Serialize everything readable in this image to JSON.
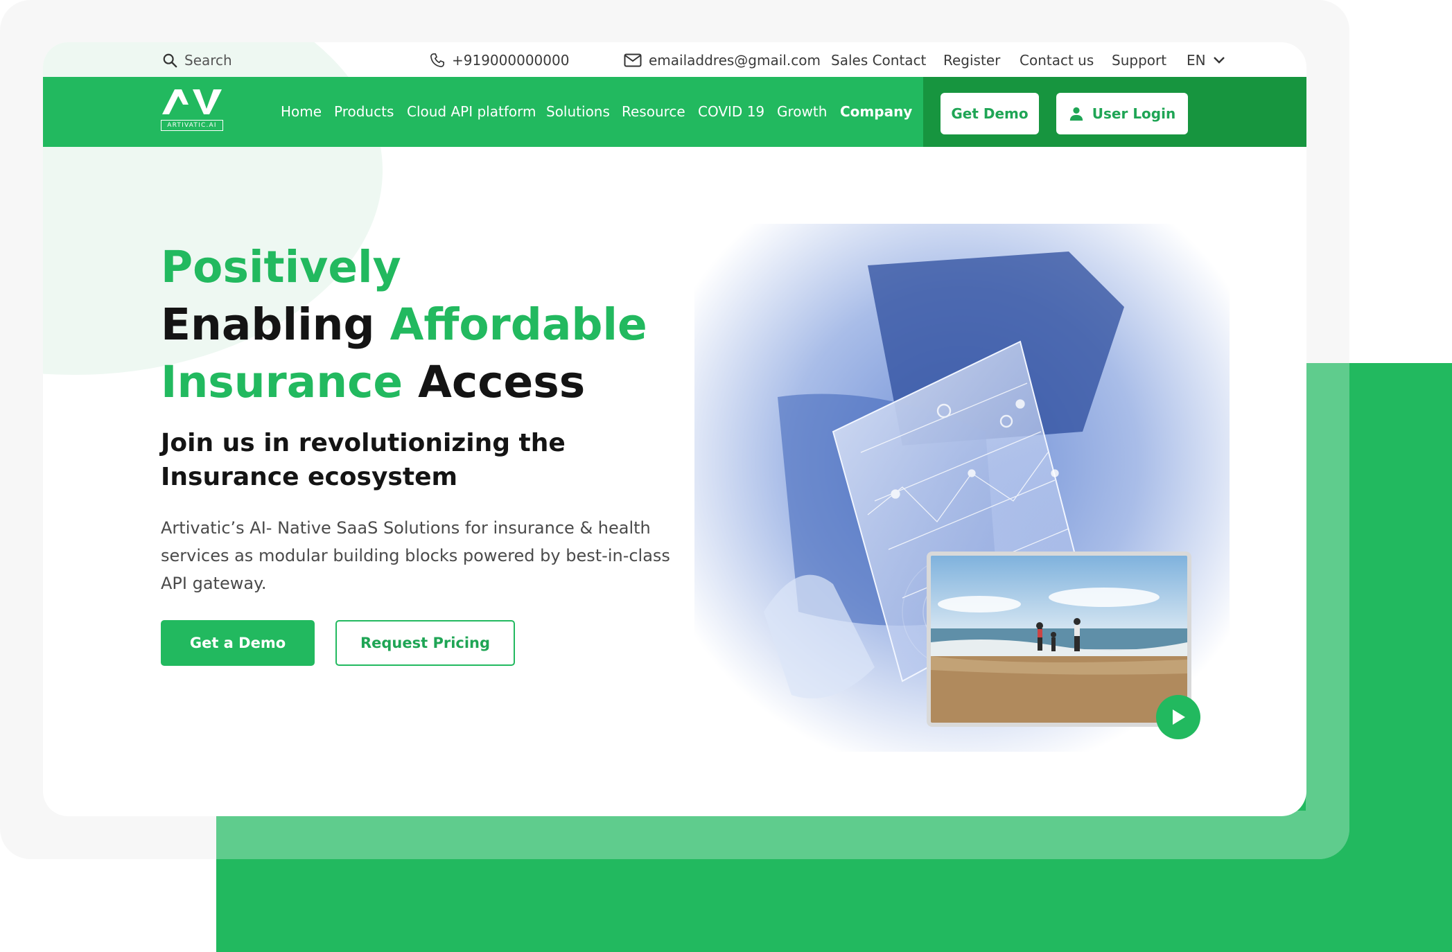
{
  "topbar": {
    "search_placeholder": "Search",
    "phone": "+919000000000",
    "email": "emailaddres@gmail.com",
    "links": [
      "Sales Contact",
      "Register",
      "Contact us",
      "Support"
    ],
    "language": "EN"
  },
  "logo": {
    "mark": "AV",
    "wordmark": "ARTIVATIC.AI"
  },
  "nav": {
    "items": [
      "Home",
      "Products",
      "Cloud API platform",
      "Solutions",
      "Resource",
      "COVID 19",
      "Growth",
      "Company"
    ],
    "get_demo": "Get Demo",
    "user_login": "User Login"
  },
  "hero": {
    "line1": "Positively",
    "line2_a": "Enabling",
    "line2_b": "Affordable",
    "line3_a": "Insurance",
    "line3_b": "Access",
    "subtitle": "Join us in revolutionizing the Insurance ecosystem",
    "description": "Artivatic’s AI- Native SaaS Solutions for insurance & health services as modular building blocks powered by best-in-class API gateway.",
    "cta_primary": "Get a Demo",
    "cta_secondary": "Request Pricing"
  },
  "colors": {
    "brand_green": "#22b95f",
    "brand_dark_green": "#17953f",
    "text_dark": "#141414"
  },
  "icons": [
    "search-icon",
    "phone-icon",
    "mail-icon",
    "chevron-down-icon",
    "user-icon",
    "play-icon"
  ]
}
